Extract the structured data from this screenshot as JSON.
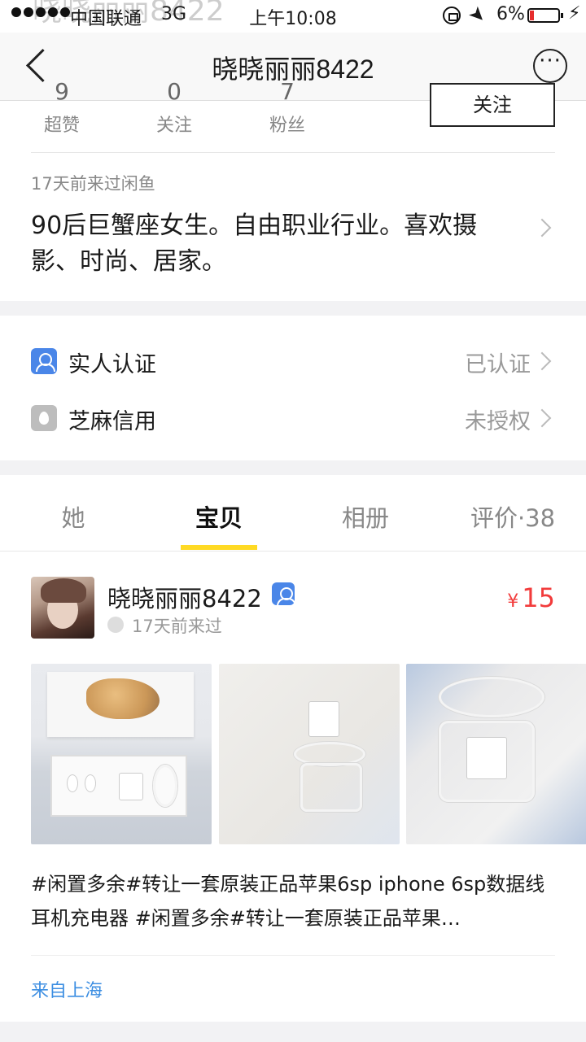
{
  "status_bar": {
    "carrier": "中国联通",
    "network": "3G",
    "time": "上午10:08",
    "battery": "6%",
    "ghost_title": "晓晓丽丽8422"
  },
  "nav": {
    "title": "晓晓丽丽8422",
    "more": "···"
  },
  "profile": {
    "stats": [
      {
        "value": "9",
        "label": "超赞"
      },
      {
        "value": "0",
        "label": "关注"
      },
      {
        "value": "7",
        "label": "粉丝"
      }
    ],
    "follow_button": "关注",
    "last_seen": "17天前来过闲鱼",
    "bio": "90后巨蟹座女生。自由职业行业。喜欢摄影、时尚、居家。"
  },
  "verification": [
    {
      "icon": "person-verify-icon",
      "label": "实人认证",
      "status": "已认证"
    },
    {
      "icon": "sesame-credit-icon",
      "label": "芝麻信用",
      "status": "未授权"
    }
  ],
  "tabs": [
    {
      "label": "她"
    },
    {
      "label": "宝贝"
    },
    {
      "label": "相册"
    },
    {
      "label": "评价·38"
    }
  ],
  "active_tab": "宝贝",
  "item": {
    "seller_name": "晓晓丽丽8422",
    "seller_seen": "17天前来过",
    "currency": "¥",
    "price": "15",
    "description": "#闲置多余#转让一套原装正品苹果6sp iphone 6sp数据线耳机充电器 #闲置多余#转让一套原装正品苹果…",
    "location": "来自上海"
  },
  "colors": {
    "accent_yellow": "#ffda24",
    "price_red": "#f23b3b",
    "link_blue": "#3c8ee2",
    "verify_blue": "#4a86e8"
  }
}
